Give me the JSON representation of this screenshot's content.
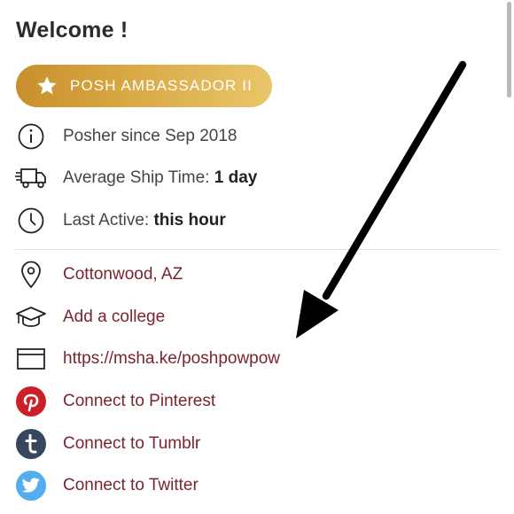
{
  "header": {
    "title": "Welcome !"
  },
  "badge": {
    "label": "POSH AMBASSADOR II",
    "icon": "star-icon",
    "colors": [
      "#c88f2c",
      "#e9c66a"
    ]
  },
  "stats": {
    "since": "Posher since Sep 2018",
    "ship_label": "Average Ship Time: ",
    "ship_value": "1 day",
    "active_label": "Last Active: ",
    "active_value": "this hour"
  },
  "links": {
    "location": "Cottonwood, AZ",
    "college": "Add a college",
    "website": "https://msha.ke/poshpowpow",
    "pinterest": "Connect to Pinterest",
    "tumblr": "Connect to Tumblr",
    "twitter": "Connect to Twitter"
  },
  "colors": {
    "link": "#7a2430",
    "pinterest": "#cb2027",
    "tumblr": "#36465d",
    "twitter": "#55acee",
    "arrow": "#000000"
  }
}
